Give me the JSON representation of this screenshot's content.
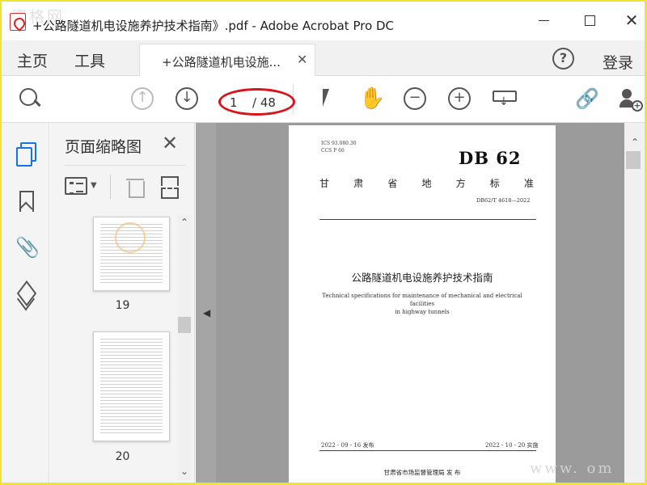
{
  "window": {
    "title": "+公路隧道机电设施养护技术指南》.pdf - Adobe Acrobat Pro DC",
    "watermark_top": "资格网",
    "watermark_bottom": "www.            om"
  },
  "menubar": {
    "home": "主页",
    "tools": "工具",
    "doc_tab": "+公路隧道机电设施...",
    "login": "登录"
  },
  "toolbar": {
    "page_current": "1",
    "page_total": "/ 48"
  },
  "thumbnails": {
    "title": "页面缩略图",
    "pages": [
      "19",
      "20"
    ]
  },
  "pdf_page": {
    "ics": "ICS  93.080.30",
    "ccs": "CCS  P 66",
    "db": "DB 62",
    "standard": [
      "甘",
      "肃",
      "省",
      "地",
      "方",
      "标",
      "准"
    ],
    "code": "DB62/T 4618—2022",
    "title": "公路隧道机电设施养护技术指南",
    "title_en_1": "Technical specifications for maintenance of mechanical and electrical facilities",
    "title_en_2": "in highway tunnels",
    "issue_date": "2022 - 09 - 16 发布",
    "impl_date": "2022 - 10 - 20 实施",
    "publisher": "甘肃省市场监督管理局        发 布"
  },
  "colors": {
    "accent": "#1473e6",
    "highlight_oval": "#d8141a",
    "frame": "#f2e332"
  }
}
